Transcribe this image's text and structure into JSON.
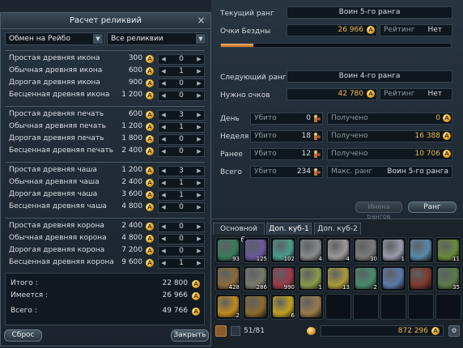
{
  "relic_window": {
    "title": "Расчет реликвий",
    "close": "×",
    "exchange_dropdown": "Обмен на Рейбо",
    "filter_dropdown": "Все реликвии",
    "coin_glyph": "A",
    "groups": [
      {
        "items": [
          {
            "name": "Простая древняя икона",
            "price": "300",
            "qty": "0"
          },
          {
            "name": "Обычная древняя икона",
            "price": "600",
            "qty": "1"
          },
          {
            "name": "Дорогая древняя икона",
            "price": "900",
            "qty": "0"
          },
          {
            "name": "Бесценная древняя икона",
            "price": "1 200",
            "qty": "0"
          }
        ]
      },
      {
        "items": [
          {
            "name": "Простая древняя печать",
            "price": "600",
            "qty": "3"
          },
          {
            "name": "Обычная древняя печать",
            "price": "1 200",
            "qty": "1"
          },
          {
            "name": "Дорогая древняя печать",
            "price": "1 800",
            "qty": "0"
          },
          {
            "name": "Бесценная древняя печать",
            "price": "2 400",
            "qty": "0"
          }
        ]
      },
      {
        "items": [
          {
            "name": "Простая древняя чаша",
            "price": "1 200",
            "qty": "3"
          },
          {
            "name": "Обычная древняя чаша",
            "price": "2 400",
            "qty": "1"
          },
          {
            "name": "Дорогая древняя чаша",
            "price": "3 600",
            "qty": "1"
          },
          {
            "name": "Бесценная древняя чаша",
            "price": "4 800",
            "qty": "0"
          }
        ]
      },
      {
        "items": [
          {
            "name": "Простая древняя корона",
            "price": "2 400",
            "qty": "0"
          },
          {
            "name": "Обычная древняя корона",
            "price": "4 800",
            "qty": "0"
          },
          {
            "name": "Дорогая древняя корона",
            "price": "7 200",
            "qty": "0"
          },
          {
            "name": "Бесценная древняя корона",
            "price": "9 600",
            "qty": "1"
          }
        ]
      }
    ],
    "totals": {
      "total_label": "Итого :",
      "total_value": "22 800",
      "have_label": "Имеется :",
      "have_value": "26 966",
      "all_label": "Всего :",
      "all_value": "49 766"
    },
    "reset_button": "Сброс",
    "close_button": "Закрыть"
  },
  "rank": {
    "current_rank_label": "Текущий ранг",
    "current_rank_value": "Воин 5-го ранга",
    "abyss_points_label": "Очки Бездны",
    "abyss_points_value": "26 966",
    "rating_label": "Рейтинг",
    "rating_value": "Нет",
    "progress_percent": 14,
    "next_rank_label": "Следующий ранг",
    "next_rank_value": "Воин 4-го ранга",
    "points_needed_label": "Нужно очков",
    "points_needed_value": "42 780",
    "rating2_label": "Рейтинг",
    "rating2_value": "Нет",
    "stats": [
      {
        "period": "День",
        "kills_label": "Убито",
        "kills": "0",
        "got_label": "Получено",
        "got": "0"
      },
      {
        "period": "Неделя",
        "kills_label": "Убито",
        "kills": "18",
        "got_label": "Получено",
        "got": "16 388"
      },
      {
        "period": "Ранее",
        "kills_label": "Убито",
        "kills": "12",
        "got_label": "Получено",
        "got": "10 706"
      },
      {
        "period": "Всего",
        "kills_label": "Убито",
        "kills": "234",
        "got_label": "Макс. ранг",
        "got": "Воин 5-го ранга"
      }
    ],
    "name_rating_button": "Имена рангов",
    "rank_button": "Ранг"
  },
  "inventory": {
    "tabs": [
      "Основной куб",
      "Доп. куб-1",
      "Доп. куб-2"
    ],
    "active_tab": 1,
    "slots": [
      {
        "icon": "scroll-icon",
        "color": "#3a7a5a",
        "count": "93"
      },
      {
        "icon": "scroll-icon",
        "color": "#6a5a9a",
        "count": "125"
      },
      {
        "icon": "scroll-icon",
        "color": "#4a9a8a",
        "count": "102"
      },
      {
        "icon": "scroll-icon",
        "color": "#8a8a8a",
        "count": "4"
      },
      {
        "icon": "scroll-icon",
        "color": "#9a9a9a",
        "count": "4"
      },
      {
        "icon": "scroll-icon",
        "color": "#7a7a7a",
        "count": "30"
      },
      {
        "icon": "scroll-icon",
        "color": "#9a9aaa",
        "count": "1"
      },
      {
        "icon": "map-icon",
        "color": "#5a8aaa",
        "count": ""
      },
      {
        "icon": "scroll-icon",
        "color": "#6a8a3a",
        "count": "11"
      },
      {
        "icon": "scroll-icon",
        "color": "#8a6a3a",
        "count": "428"
      },
      {
        "icon": "scroll-icon",
        "color": "#7a7a6a",
        "count": "286"
      },
      {
        "icon": "crystal-icon",
        "color": "#9a3a4a",
        "count": "990"
      },
      {
        "icon": "feather-icon",
        "color": "#8a9a4a",
        "count": "1"
      },
      {
        "icon": "feather-icon",
        "color": "#aa9a3a",
        "count": "13"
      },
      {
        "icon": "orb-icon",
        "color": "#4a8a6a",
        "count": "2"
      },
      {
        "icon": "scroll-icon",
        "color": "#5a7aaa",
        "count": ""
      },
      {
        "icon": "book-icon",
        "color": "#7a3a2a",
        "count": ""
      },
      {
        "icon": "wing-icon",
        "color": "#5a7a4a",
        "count": "35"
      },
      {
        "icon": "coin-icon",
        "color": "#c08a20",
        "count": "2"
      },
      {
        "icon": "acorn-icon",
        "color": "#8a6a2a",
        "count": ""
      },
      {
        "icon": "gold-cube-icon",
        "color": "#c0a020",
        "count": "6"
      },
      {
        "icon": "scroll-icon",
        "color": "#9a7a4a",
        "count": ""
      }
    ],
    "slots_used": "51/81",
    "money": "872 296"
  }
}
